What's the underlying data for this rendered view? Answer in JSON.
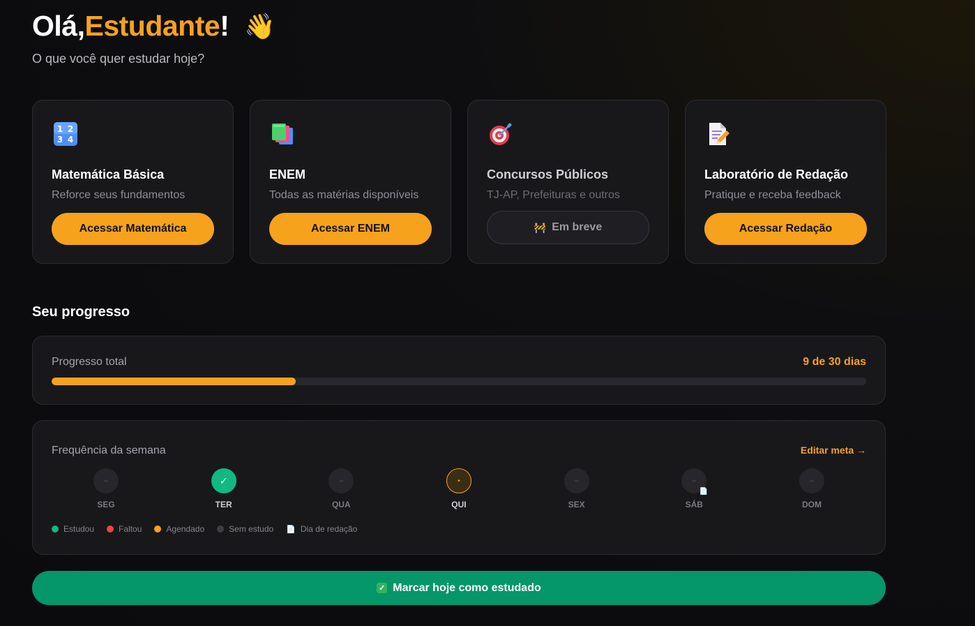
{
  "header": {
    "greeting_prefix": "Olá, ",
    "name": "Estudante",
    "greeting_suffix": "!",
    "wave_icon": "👋",
    "subtitle": "O que você quer estudar hoje?"
  },
  "cards": [
    {
      "icon": "numbers-icon",
      "title": "Matemática Básica",
      "description": "Reforce seus fundamentos",
      "button": "Acessar Matemática",
      "enabled": true
    },
    {
      "icon": "books-icon",
      "title": "ENEM",
      "description": "Todas as matérias disponíveis",
      "button": "Acessar ENEM",
      "enabled": true
    },
    {
      "icon": "target-icon",
      "title": "Concursos Públicos",
      "description": "TJ-AP, Prefeituras e outros",
      "button_icon": "🚧",
      "button": "Em breve",
      "enabled": false
    },
    {
      "icon": "document-pencil-icon",
      "title": "Laboratório de Redação",
      "description": "Pratique e receba feedback",
      "button": "Acessar Redação",
      "enabled": true
    }
  ],
  "progress": {
    "section_title": "Seu progresso",
    "label": "Progresso total",
    "count_text": "9 de 30 dias",
    "done": 9,
    "total": 30
  },
  "frequency": {
    "label": "Frequência da semana",
    "edit_link": "Editar meta →",
    "days": [
      {
        "name": "SEG",
        "status": "none",
        "symbol": "–"
      },
      {
        "name": "TER",
        "status": "studied",
        "symbol": "✓"
      },
      {
        "name": "QUA",
        "status": "none",
        "symbol": "–"
      },
      {
        "name": "QUI",
        "status": "scheduled",
        "symbol": "•"
      },
      {
        "name": "SEX",
        "status": "none",
        "symbol": "–"
      },
      {
        "name": "SÁB",
        "status": "none",
        "symbol": "–",
        "essay_day": true
      },
      {
        "name": "DOM",
        "status": "none",
        "symbol": "–"
      }
    ],
    "legend": [
      {
        "label": "Estudou",
        "color": "#10b981"
      },
      {
        "label": "Faltou",
        "color": "#ef4444"
      },
      {
        "label": "Agendado",
        "color": "#f6a21d"
      },
      {
        "label": "Sem estudo",
        "color": "#3f3f46"
      },
      {
        "label": "Dia de redação",
        "icon": "📄"
      }
    ]
  },
  "cta": {
    "icon": "✓",
    "label": "Marcar hoje como estudado"
  },
  "colors": {
    "accent": "#f6a21d",
    "success": "#059669",
    "background": "#0b0b0d",
    "card": "#18181b"
  }
}
